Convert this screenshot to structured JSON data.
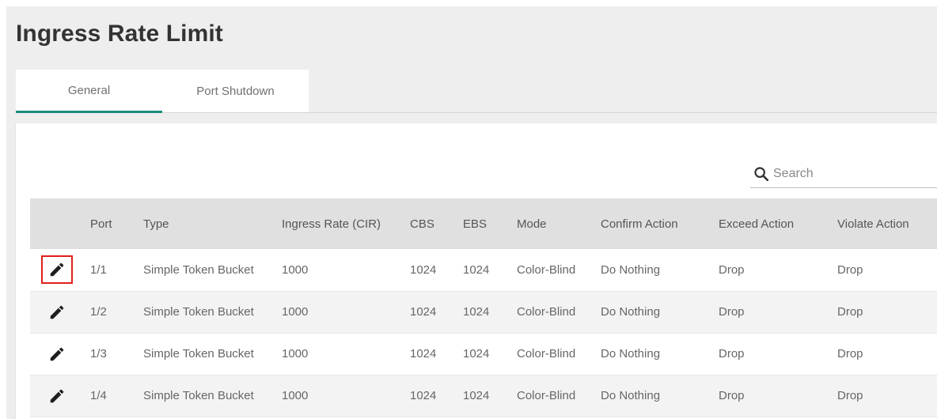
{
  "page": {
    "title": "Ingress Rate Limit"
  },
  "tabs": [
    {
      "label": "General",
      "active": true
    },
    {
      "label": "Port Shutdown",
      "active": false
    }
  ],
  "search": {
    "placeholder": "Search",
    "value": ""
  },
  "table": {
    "columns": [
      "",
      "Port",
      "Type",
      "Ingress Rate (CIR)",
      "CBS",
      "EBS",
      "Mode",
      "Confirm Action",
      "Exceed Action",
      "Violate Action"
    ],
    "rows": [
      {
        "port": "1/1",
        "type": "Simple Token Bucket",
        "cir": "1000",
        "cbs": "1024",
        "ebs": "1024",
        "mode": "Color-Blind",
        "confirm": "Do Nothing",
        "exceed": "Drop",
        "violate": "Drop"
      },
      {
        "port": "1/2",
        "type": "Simple Token Bucket",
        "cir": "1000",
        "cbs": "1024",
        "ebs": "1024",
        "mode": "Color-Blind",
        "confirm": "Do Nothing",
        "exceed": "Drop",
        "violate": "Drop"
      },
      {
        "port": "1/3",
        "type": "Simple Token Bucket",
        "cir": "1000",
        "cbs": "1024",
        "ebs": "1024",
        "mode": "Color-Blind",
        "confirm": "Do Nothing",
        "exceed": "Drop",
        "violate": "Drop"
      },
      {
        "port": "1/4",
        "type": "Simple Token Bucket",
        "cir": "1000",
        "cbs": "1024",
        "ebs": "1024",
        "mode": "Color-Blind",
        "confirm": "Do Nothing",
        "exceed": "Drop",
        "violate": "Drop"
      }
    ]
  },
  "colors": {
    "accent": "#1a8a7c",
    "highlight": "#e0201b"
  },
  "icons": {
    "edit": "pencil-icon",
    "search": "search-icon"
  }
}
